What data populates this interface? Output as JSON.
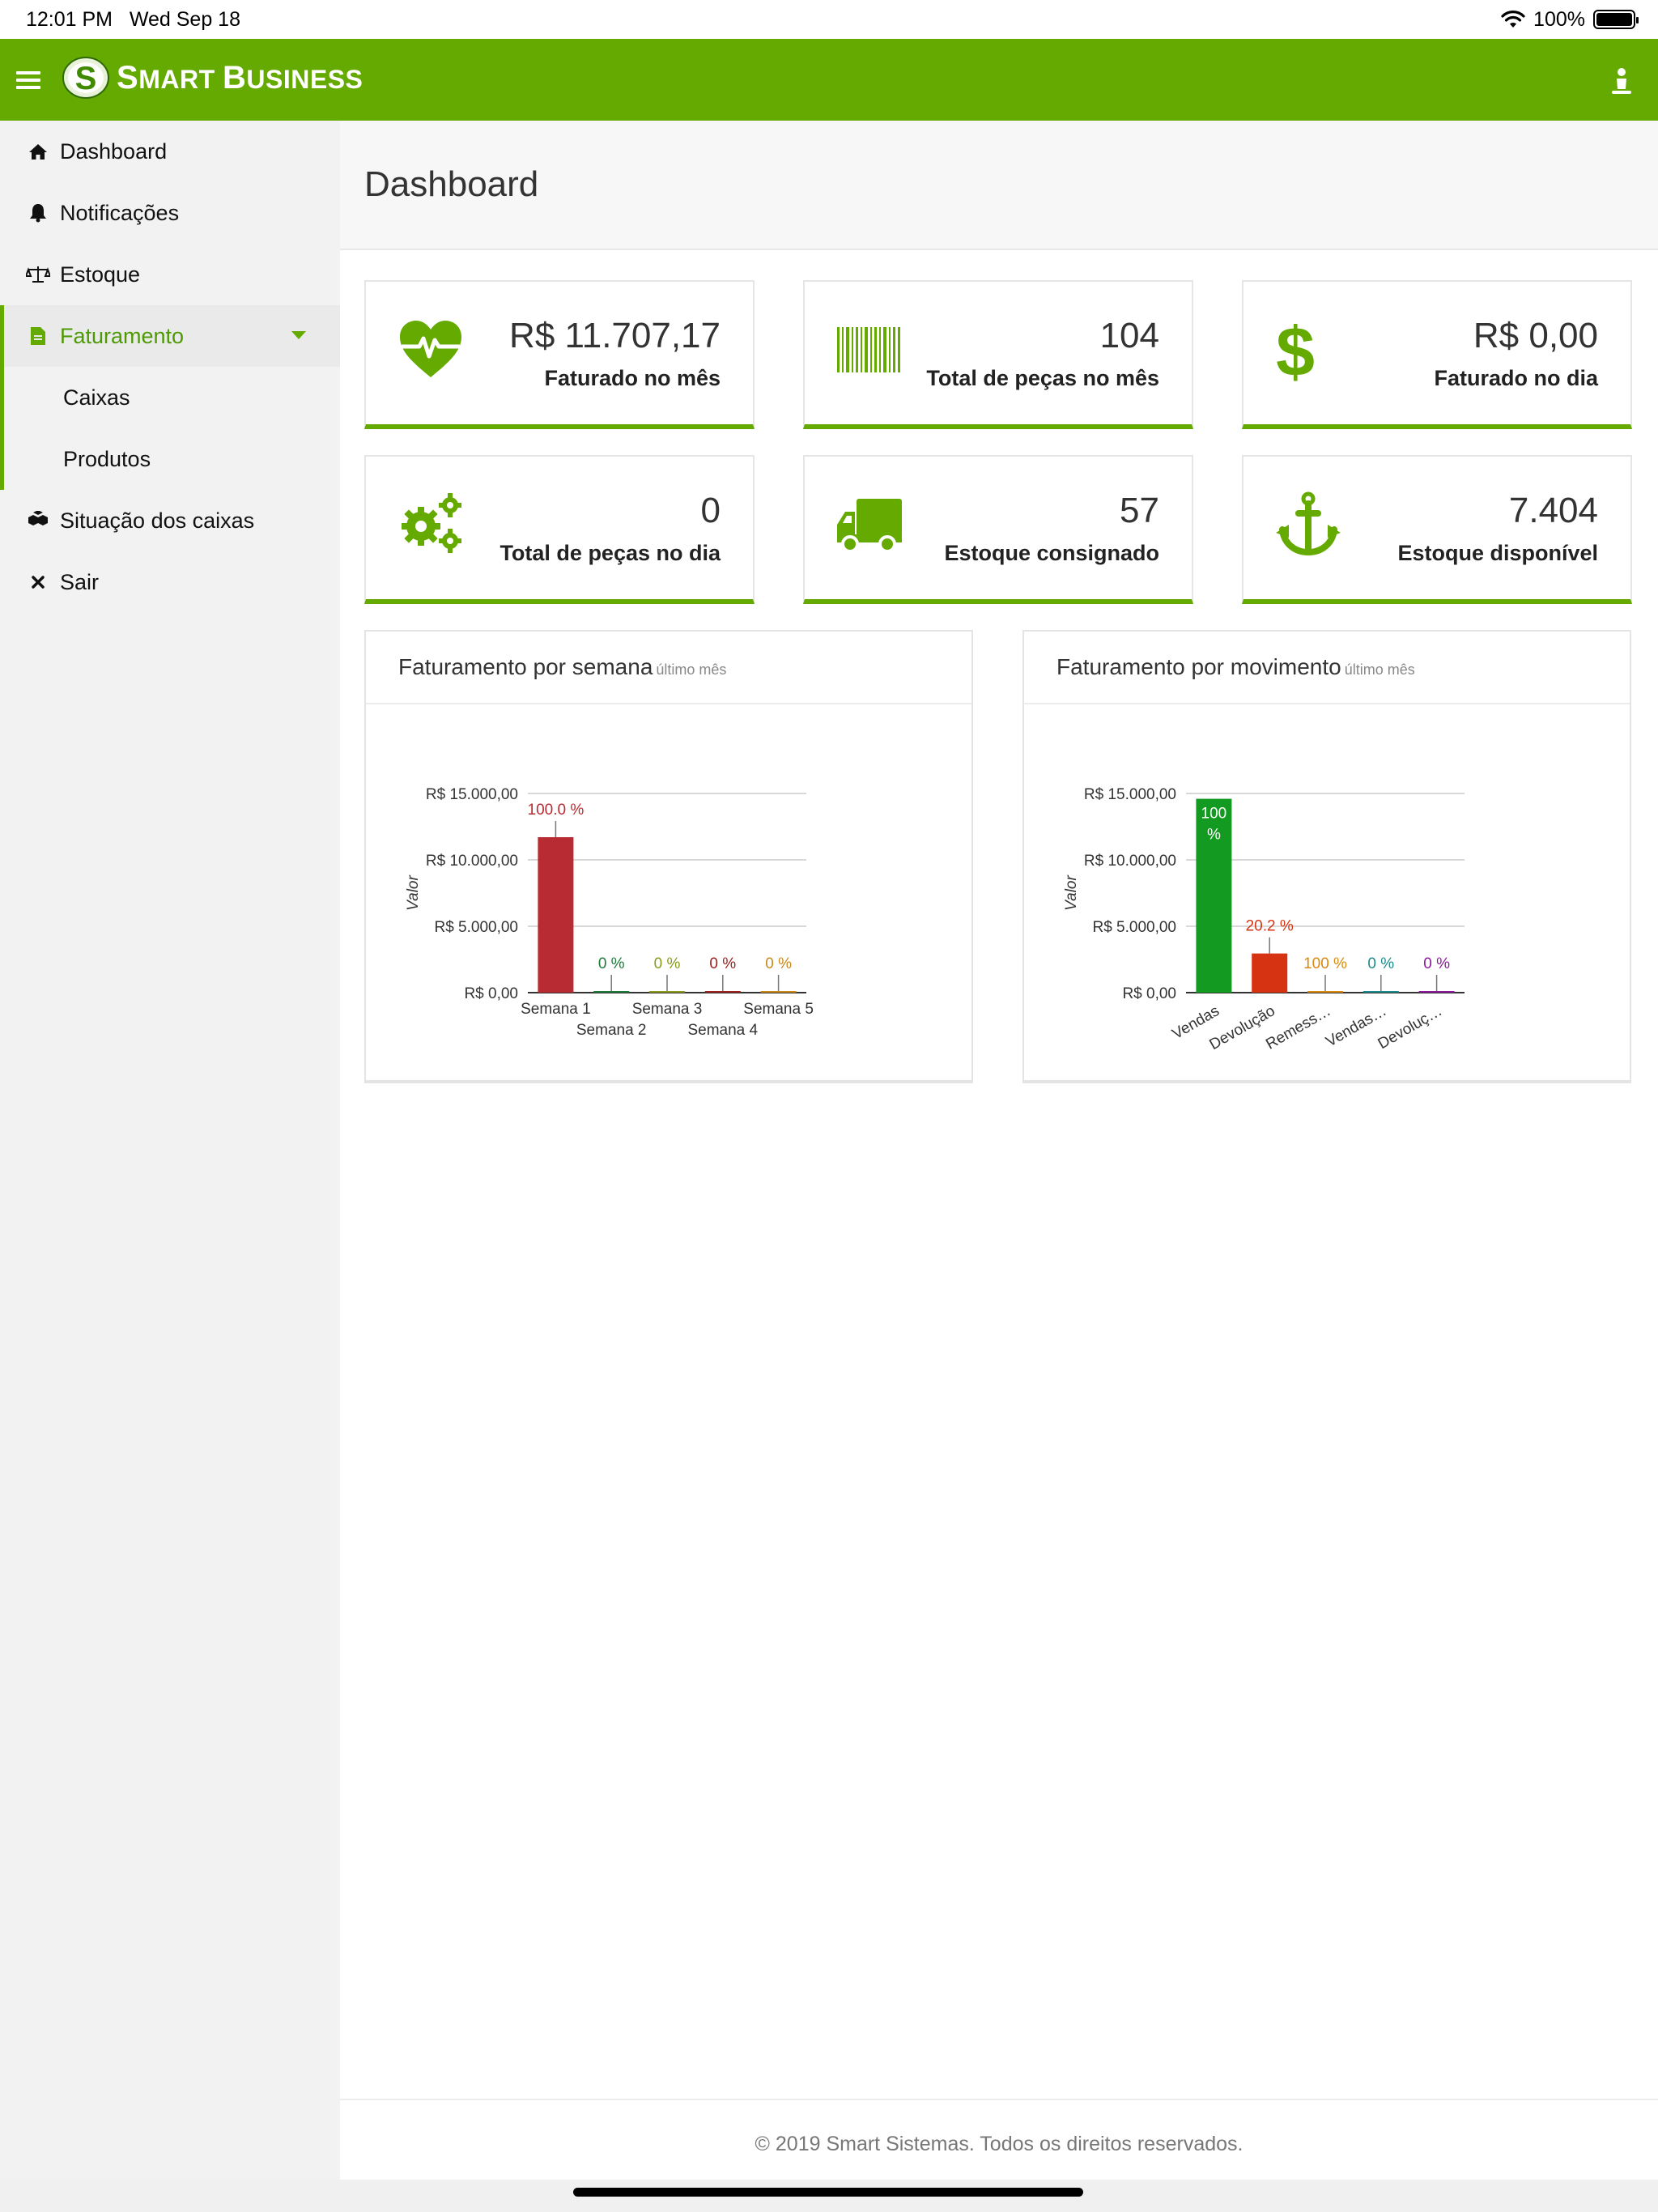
{
  "status_bar": {
    "time": "12:01 PM",
    "date": "Wed Sep 18",
    "battery": "100%"
  },
  "header": {
    "brand": "Smart Business",
    "brand_parts": [
      "S",
      "MART ",
      "B",
      "USINESS"
    ]
  },
  "sidebar": {
    "items": [
      {
        "label": "Dashboard",
        "icon": "home-icon"
      },
      {
        "label": "Notificações",
        "icon": "bell-icon"
      },
      {
        "label": "Estoque",
        "icon": "balance-scale-icon"
      },
      {
        "label": "Faturamento",
        "icon": "file-icon",
        "expanded": true
      },
      {
        "label": "Caixas"
      },
      {
        "label": "Produtos"
      },
      {
        "label": "Situação dos caixas",
        "icon": "cubes-icon"
      },
      {
        "label": "Sair",
        "icon": "close-icon"
      }
    ]
  },
  "main": {
    "title": "Dashboard",
    "cards": [
      {
        "value": "R$ 11.707,17",
        "label": "Faturado no mês",
        "icon": "heartbeat-icon"
      },
      {
        "value": "104",
        "label": "Total de peças no mês",
        "icon": "barcode-icon"
      },
      {
        "value": "R$ 0,00",
        "label": "Faturado no dia",
        "icon": "dollar-icon"
      },
      {
        "value": "0",
        "label": "Total de peças no dia",
        "icon": "gears-icon"
      },
      {
        "value": "57",
        "label": "Estoque consignado",
        "icon": "truck-icon"
      },
      {
        "value": "7.404",
        "label": "Estoque disponível",
        "icon": "anchor-icon"
      }
    ],
    "panels": [
      {
        "title": "Faturamento por semana",
        "subtitle": "último mês"
      },
      {
        "title": "Faturamento por movimento",
        "subtitle": "último mês"
      }
    ]
  },
  "chart_data": [
    {
      "type": "bar",
      "title": "Faturamento por semana",
      "ylabel": "Valor",
      "ylim": [
        0,
        15000
      ],
      "yticks": [
        "R$ 0,00",
        "R$ 5.000,00",
        "R$ 10.000,00",
        "R$ 15.000,00"
      ],
      "categories": [
        "Semana 1",
        "Semana 2",
        "Semana 3",
        "Semana 4",
        "Semana 5"
      ],
      "values": [
        11707.17,
        0,
        0,
        0,
        0
      ],
      "labels": [
        "100.0 %",
        "0 %",
        "0 %",
        "0 %",
        "0 %"
      ],
      "colors": [
        "#b92b33",
        "#1e7b3a",
        "#8a9a1a",
        "#9b2020",
        "#c98a1a"
      ]
    },
    {
      "type": "bar",
      "title": "Faturamento por movimento",
      "ylabel": "Valor",
      "ylim": [
        0,
        15000
      ],
      "yticks": [
        "R$ 0,00",
        "R$ 5.000,00",
        "R$ 10.000,00",
        "R$ 15.000,00"
      ],
      "categories": [
        "Vendas",
        "Devolução",
        "Remess…",
        "Vendas…",
        "Devoluç…"
      ],
      "values": [
        14600,
        2950,
        0,
        0,
        0
      ],
      "labels": [
        "100 %",
        "20.2 %",
        "100 %",
        "0 %",
        "0 %"
      ],
      "colors": [
        "#139a21",
        "#d63313",
        "#d98a10",
        "#1b8a8a",
        "#8a1a9a"
      ]
    }
  ],
  "footer": {
    "text": "© 2019 Smart Sistemas. Todos os direitos reservados."
  },
  "colors": {
    "brand": "#64aa00",
    "active_text": "#4e9a06"
  }
}
